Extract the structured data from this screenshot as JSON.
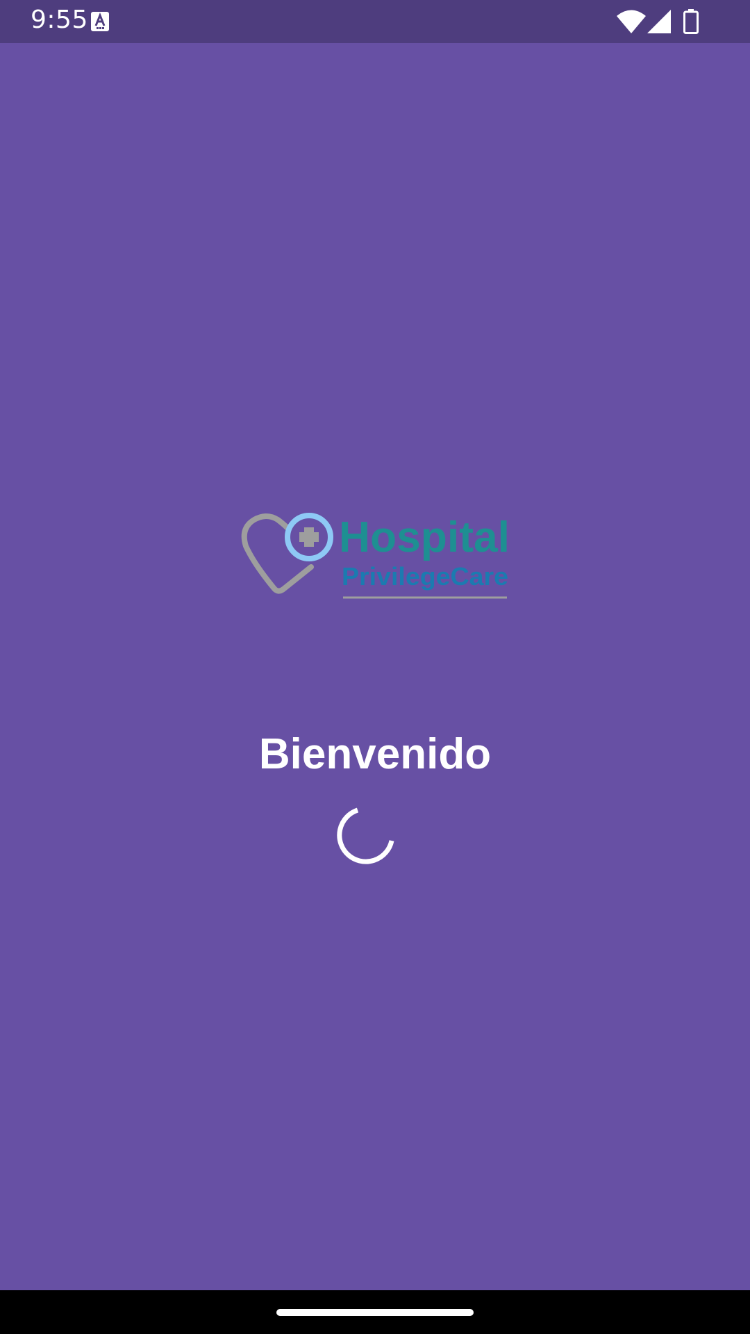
{
  "status_bar": {
    "time": "9:55",
    "notification_icon": "a-icon",
    "icons": [
      "wifi-icon",
      "cell-signal-icon",
      "battery-icon"
    ]
  },
  "logo": {
    "title": "Hospital",
    "subtitle": "PrivilegeCare",
    "title_color": "#1E8F92",
    "subtitle_color": "#1B7BB0",
    "heart_color": "#9E9E9E",
    "circle_color": "#8EC9F5"
  },
  "splash": {
    "welcome_text": "Bienvenido",
    "loading_icon": "loading-spinner-icon"
  },
  "colors": {
    "background": "#6750A4",
    "status_bar": "#4E3D7E",
    "nav_bar": "#000000",
    "text": "#FFFFFF"
  }
}
